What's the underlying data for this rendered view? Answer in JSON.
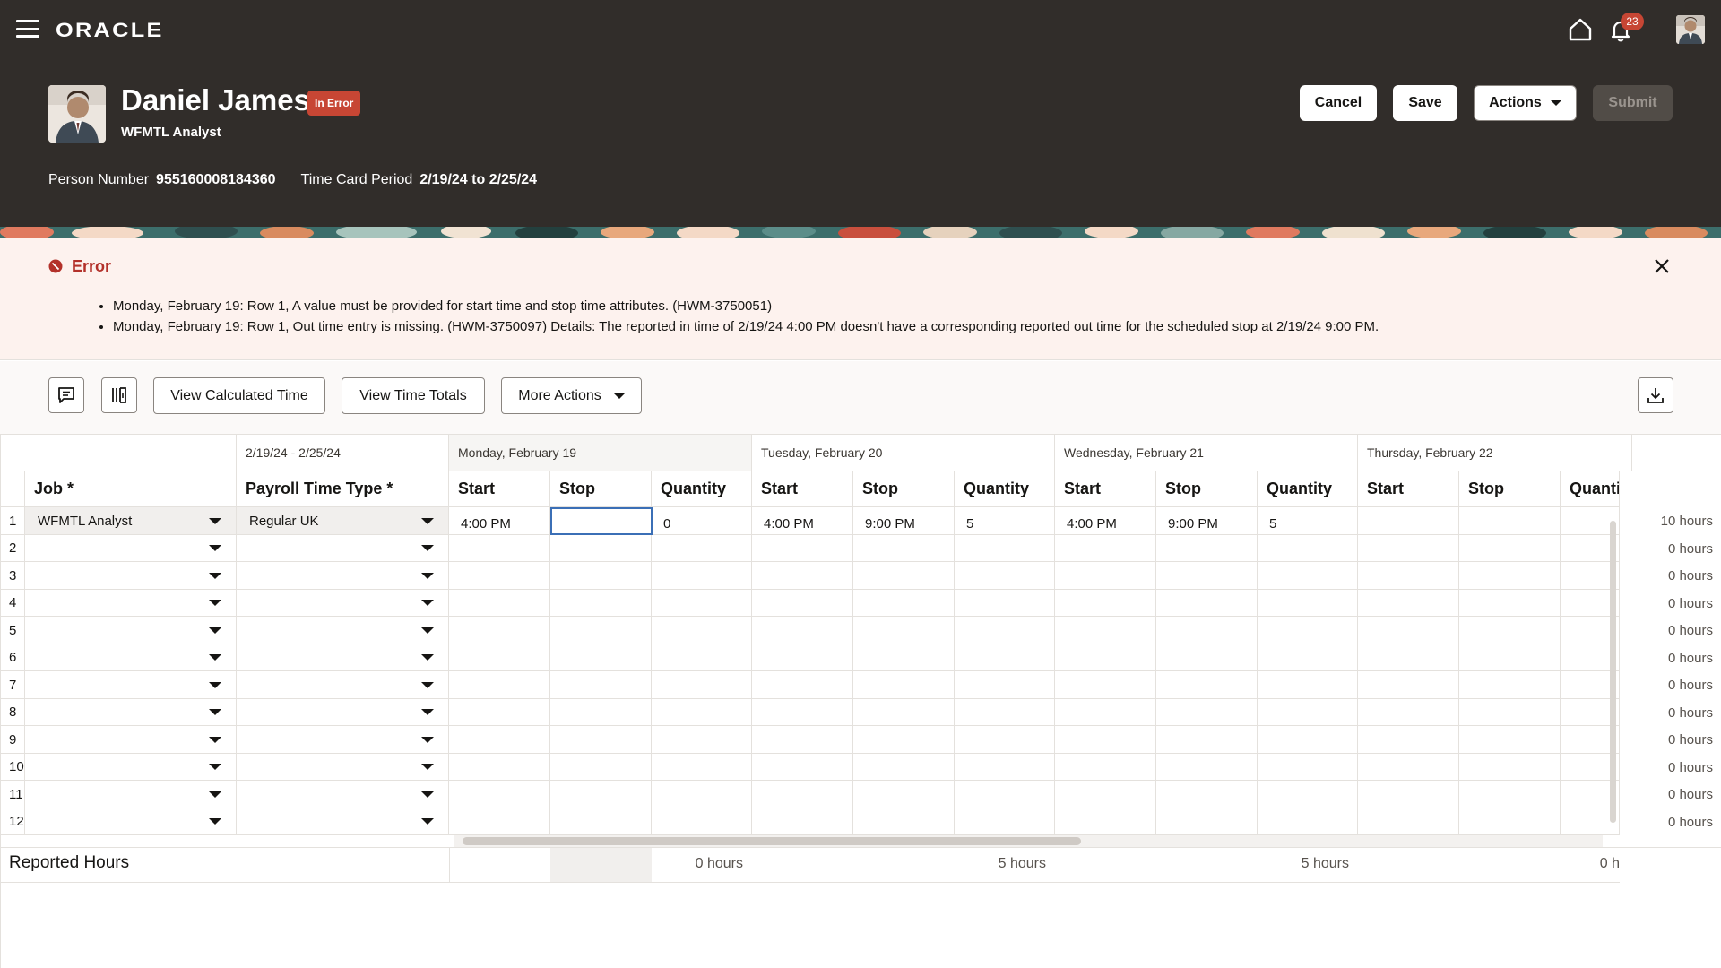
{
  "header": {
    "logo": "ORACLE",
    "notification_count": "23",
    "person_name": "Daniel James",
    "status": "In Error",
    "role": "WFMTL Analyst",
    "buttons": {
      "cancel": "Cancel",
      "save": "Save",
      "actions": "Actions",
      "submit": "Submit"
    },
    "person_number_label": "Person Number",
    "person_number": "955160008184360",
    "period_label": "Time Card Period",
    "period": "2/19/24 to 2/25/24"
  },
  "error": {
    "title": "Error",
    "messages": [
      "Monday, February 19: Row 1, A value must be provided for start time and stop time attributes. (HWM-3750051)",
      "Monday, February 19: Row 1, Out time entry is missing. (HWM-3750097) Details: The reported in time of 2/19/24 4:00 PM doesn't have a corresponding reported out time for the scheduled stop at 2/19/24 9:00 PM."
    ]
  },
  "toolbar": {
    "view_calculated_time": "View Calculated Time",
    "view_time_totals": "View Time Totals",
    "more_actions": "More Actions"
  },
  "grid": {
    "range_label": "2/19/24 - 2/25/24",
    "days": [
      "Monday, February 19",
      "Tuesday, February 20",
      "Wednesday, February 21",
      "Thursday, February 22"
    ],
    "col_job": "Job *",
    "col_payroll": "Payroll Time Type *",
    "col_start": "Start",
    "col_stop": "Stop",
    "col_quantity": "Quantity",
    "rows": [
      {
        "n": "1",
        "job": "WFMTL Analyst",
        "type": "Regular UK",
        "cells": [
          "4:00 PM",
          "",
          "0",
          "4:00 PM",
          "9:00 PM",
          "5",
          "4:00 PM",
          "9:00 PM",
          "5",
          "",
          "",
          ""
        ],
        "total": "10 hours"
      },
      {
        "n": "2",
        "job": "",
        "type": "",
        "cells": [],
        "total": "0 hours"
      },
      {
        "n": "3",
        "job": "",
        "type": "",
        "cells": [],
        "total": "0 hours"
      },
      {
        "n": "4",
        "job": "",
        "type": "",
        "cells": [],
        "total": "0 hours"
      },
      {
        "n": "5",
        "job": "",
        "type": "",
        "cells": [],
        "total": "0 hours"
      },
      {
        "n": "6",
        "job": "",
        "type": "",
        "cells": [],
        "total": "0 hours"
      },
      {
        "n": "7",
        "job": "",
        "type": "",
        "cells": [],
        "total": "0 hours"
      },
      {
        "n": "8",
        "job": "",
        "type": "",
        "cells": [],
        "total": "0 hours"
      },
      {
        "n": "9",
        "job": "",
        "type": "",
        "cells": [],
        "total": "0 hours"
      },
      {
        "n": "10",
        "job": "",
        "type": "",
        "cells": [],
        "total": "0 hours"
      },
      {
        "n": "11",
        "job": "",
        "type": "",
        "cells": [],
        "total": "0 hours"
      },
      {
        "n": "12",
        "job": "",
        "type": "",
        "cells": [],
        "total": "0 hours"
      }
    ],
    "reported_hours_label": "Reported Hours",
    "reported_hours": [
      "0 hours",
      "5 hours",
      "5 hours",
      "0 h"
    ]
  }
}
